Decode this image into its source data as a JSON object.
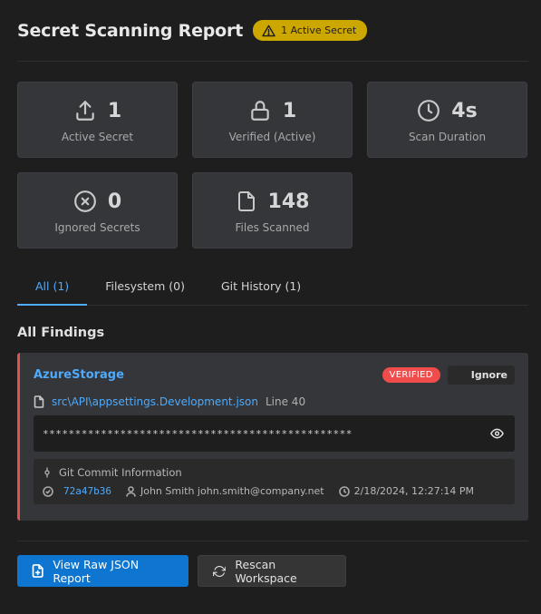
{
  "header": {
    "title": "Secret Scanning Report",
    "badge": "1 Active Secret",
    "badge_icon": "warning-icon"
  },
  "stats": [
    {
      "icon": "upload-icon",
      "value": "1",
      "label": "Active Secret"
    },
    {
      "icon": "lock-icon",
      "value": "1",
      "label": "Verified (Active)"
    },
    {
      "icon": "clock-icon",
      "value": "4s",
      "label": "Scan Duration"
    },
    {
      "icon": "x-circle-icon",
      "value": "0",
      "label": "Ignored Secrets"
    },
    {
      "icon": "file-icon",
      "value": "148",
      "label": "Files Scanned"
    }
  ],
  "tabs": [
    {
      "label": "All (1)",
      "active": true
    },
    {
      "label": "Filesystem (0)",
      "active": false
    },
    {
      "label": "Git History (1)",
      "active": false
    }
  ],
  "findings_title": "All Findings",
  "finding": {
    "detector": "AzureStorage",
    "status": "VERIFIED",
    "ignore_label": "Ignore",
    "file": "src\\API\\appsettings.Development.json",
    "line": "Line 40",
    "masked_secret": "************************************************",
    "commit_title": "Git Commit Information",
    "commit_hash": "72a47b36",
    "author": "John Smith john.smith@company.net",
    "date": "2/18/2024, 12:27:14 PM"
  },
  "actions": {
    "raw_json": "View Raw JSON Report",
    "rescan": "Rescan Workspace"
  },
  "colors": {
    "accent": "#4daafc",
    "warning": "#cca700",
    "danger": "#f14c4c",
    "primary_button": "#0e75d1"
  }
}
